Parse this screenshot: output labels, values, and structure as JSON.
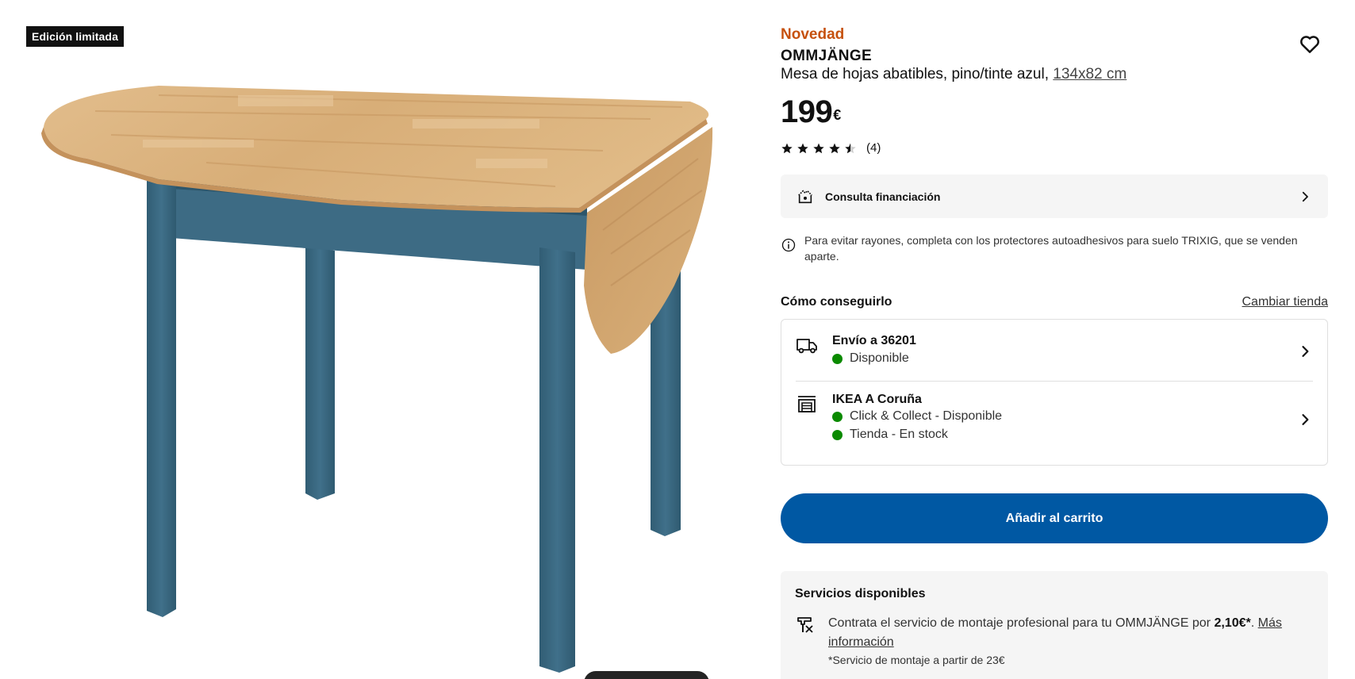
{
  "media": {
    "badge": "Edición limitada",
    "image_alt": "Mesa de hojas abatibles OMMJÄNGE con tablero de pino y patas azules"
  },
  "product": {
    "novelty": "Novedad",
    "name": "OMMJÄNGE",
    "description": "Mesa de hojas abatibles, pino/tinte azul,",
    "measure": "134x82 cm",
    "price": "199",
    "currency": "€",
    "rating": 4.5,
    "rating_count": "(4)"
  },
  "financing": {
    "label": "Consulta financiación"
  },
  "notice": {
    "text": "Para evitar rayones, completa con los protectores autoadhesivos para suelo TRIXIG, que se venden aparte."
  },
  "availability": {
    "title": "Cómo conseguirlo",
    "change_store": "Cambiar tienda",
    "delivery": {
      "title": "Envío a 36201",
      "status": "Disponible"
    },
    "store": {
      "title": "IKEA A Coruña",
      "status_collect": "Click & Collect - Disponible",
      "status_stock": "Tienda - En stock"
    }
  },
  "cart": {
    "label": "Añadir al carrito"
  },
  "services": {
    "title": "Servicios disponibles",
    "text_prefix": "Contrata el servicio de montaje profesional para tu OMMJÄNGE por",
    "price": "2,10€*",
    "period": ".",
    "link": "Más información",
    "note": "*Servicio de montaje a partir de 23€"
  },
  "colors": {
    "accent_orange": "#c6510e",
    "button_blue": "#0058a3",
    "status_green": "#0a8a00",
    "wood": "#d9b07a",
    "leg_blue": "#3f6e86"
  },
  "icons": [
    "heart-icon",
    "star-icon",
    "financing-icon",
    "info-icon",
    "truck-icon",
    "store-icon",
    "chevron-right-icon",
    "assembly-icon"
  ]
}
